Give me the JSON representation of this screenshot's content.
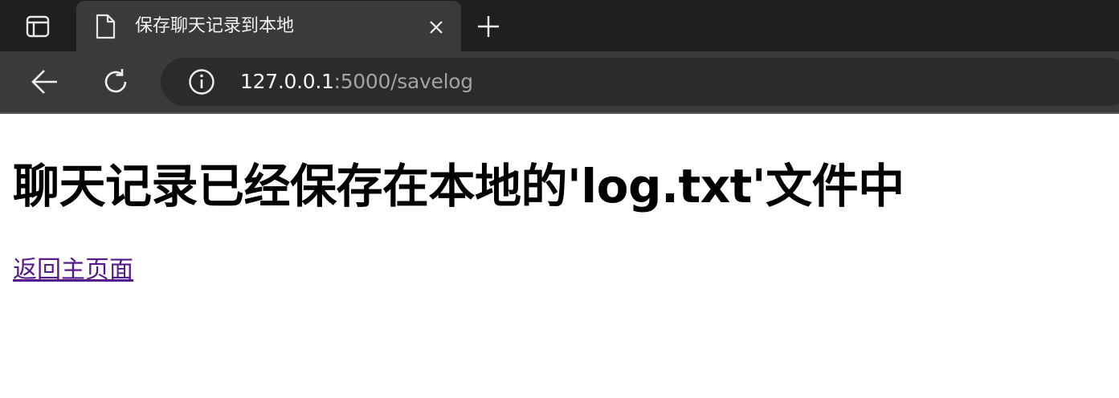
{
  "browser": {
    "tab": {
      "title": "保存聊天记录到本地",
      "favicon_icon": "document-icon",
      "close_icon": "close-icon"
    },
    "new_tab_icon": "plus-icon",
    "tab_actions_icon": "tab-actions-icon",
    "toolbar": {
      "back_icon": "arrow-left-icon",
      "reload_icon": "reload-icon",
      "site_info_icon": "info-icon"
    },
    "address": {
      "host": "127.0.0.1",
      "rest": ":5000/savelog"
    }
  },
  "page": {
    "heading": "聊天记录已经保存在本地的'log.txt'文件中",
    "back_link": "返回主页面",
    "link_color": "#551a8b"
  },
  "theme": {
    "tabstrip_bg": "#1f1f1f",
    "toolbar_bg": "#3a3a3a",
    "omnibox_bg": "#2b2b2b"
  }
}
